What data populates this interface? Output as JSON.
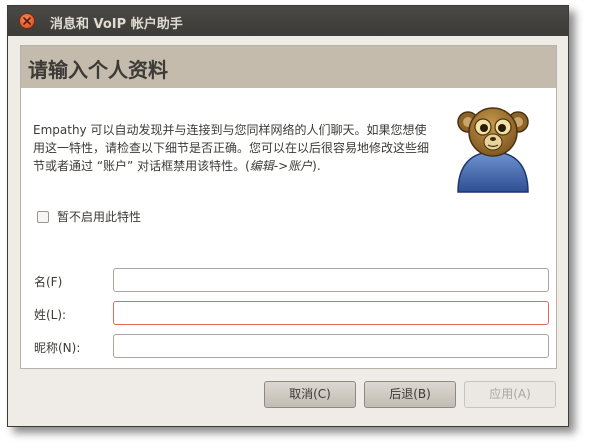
{
  "window": {
    "title": "消息和 VoIP 帐户助手"
  },
  "banner": {
    "title": "请输入个人资料"
  },
  "intro": {
    "text": "Empathy 可以自动发现并与连接到与您同样网络的人们聊天。如果您想使用这一特性，请检查以下细节是否正确。您可以在以后很容易地修改这些细节或者通过 “账户” 对话框禁用该特性。(",
    "emphasis": "编辑->账户",
    "suffix": ")."
  },
  "checkbox": {
    "label": "暂不启用此特性",
    "checked": false
  },
  "form": {
    "first_name_label": "名(F)",
    "first_name_value": "",
    "last_name_label": "姓(L):",
    "last_name_value": "",
    "nickname_label": "昵称(N):",
    "nickname_value": ""
  },
  "buttons": {
    "cancel": "取消(C)",
    "back": "后退(B)",
    "apply": "应用(A)"
  },
  "colors": {
    "titlebar": "#3c3b37",
    "banner": "#c4bbac",
    "close": "#e0571e",
    "focus_border": "#e2695a"
  },
  "icons": {
    "close": "close-icon",
    "avatar": "empathy-monkey-avatar-icon"
  }
}
